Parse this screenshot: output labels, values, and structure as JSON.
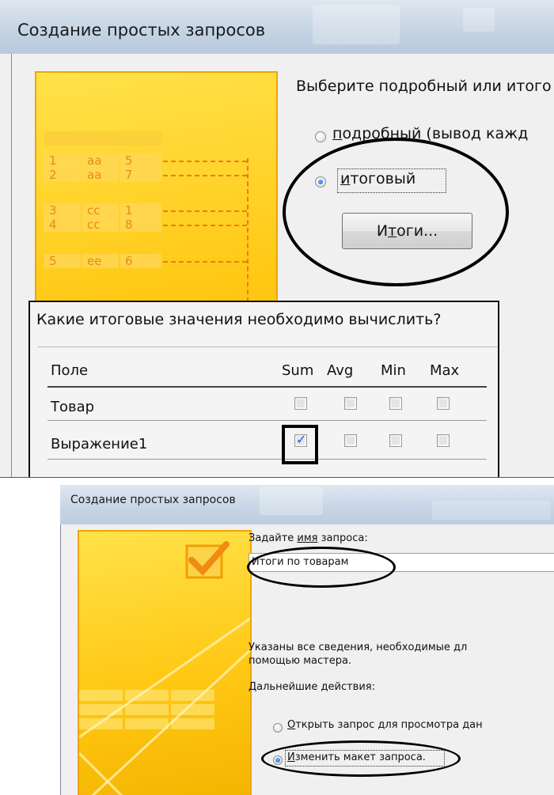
{
  "dialog_top": {
    "title": "Создание простых запросов",
    "question": "Выберите подробный или итого",
    "option_detailed": {
      "label_underlined": "п",
      "label_rest": "одробный (вывод кажд",
      "selected": false
    },
    "option_summary": {
      "label_underlined": "и",
      "label_rest": "тоговый",
      "selected": true
    },
    "summary_button": {
      "label_before": "И",
      "label_underlined": "т",
      "label_after": "оги..."
    },
    "illustration_rows": [
      [
        "1",
        "aa",
        "5"
      ],
      [
        "2",
        "aa",
        "7"
      ],
      [
        "3",
        "cc",
        "1"
      ],
      [
        "4",
        "cc",
        "8"
      ],
      [
        "5",
        "ee",
        "6"
      ]
    ],
    "summary_dialog": {
      "question": "Какие итоговые значения необходимо вычислить?",
      "field_header": "Поле",
      "functions": [
        "Sum",
        "Avg",
        "Min",
        "Max"
      ],
      "rows": [
        {
          "field": "Товар",
          "checked": [
            false,
            false,
            false,
            false
          ]
        },
        {
          "field": "Выражение1",
          "checked": [
            true,
            false,
            false,
            false
          ]
        }
      ]
    }
  },
  "dialog_bottom": {
    "title": "Создание простых запросов",
    "name_label_before": "Задайте ",
    "name_label_underlined": "имя",
    "name_label_after": " запроса:",
    "query_name_value": "Итоги по товарам",
    "info_line1": "Указаны все сведения, необходимые дл",
    "info_line2": "помощью мастера.",
    "next_actions_label": "Дальнейшие действия:",
    "option_open": {
      "label_underlined": "О",
      "label_rest": "ткрыть запрос для просмотра дан",
      "selected": false
    },
    "option_modify": {
      "label_underlined": "И",
      "label_rest": "зменить макет запроса.",
      "selected": true
    }
  },
  "colors": {
    "illustration_yellow": "#ffc814",
    "illustration_orange": "#f07a12",
    "titlebar_blue": "#c4d3e3",
    "dialog_bg": "#f0f0f0",
    "annotation": "#000000"
  }
}
